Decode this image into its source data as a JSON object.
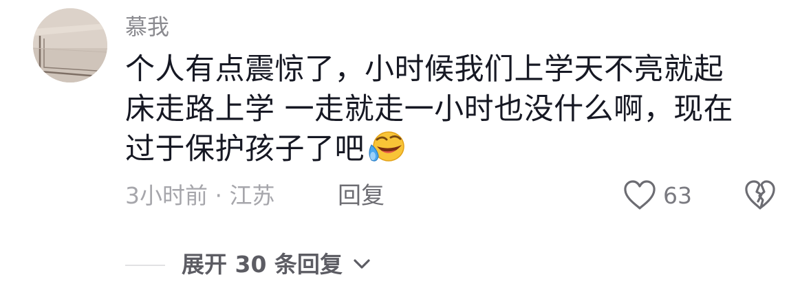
{
  "comment": {
    "username": "慕我",
    "lines": [
      "个人有点震惊了，小时候我们上学天不亮就起",
      "床走路上学 一走就走一小时也没什么啊，现在",
      "过于保护孩子了吧"
    ],
    "emoji": "laughing-crying-emoji",
    "time": "3小时前",
    "separator": "·",
    "location": "江苏",
    "reply_label": "回复",
    "like_count": "63"
  },
  "expand": {
    "label": "展开 30 条回复"
  },
  "colors": {
    "text_primary": "#161823",
    "text_secondary": "#a6a6ab",
    "username": "#8a8a8f"
  }
}
